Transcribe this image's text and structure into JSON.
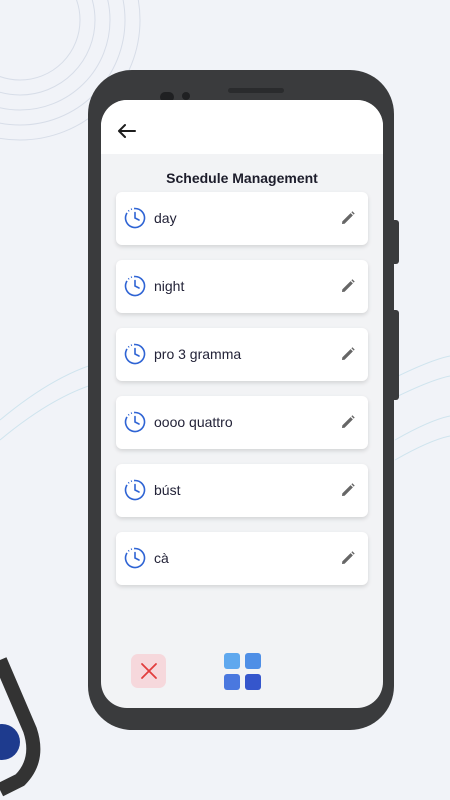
{
  "header": {
    "back_icon": "arrow-left-icon"
  },
  "page": {
    "title": "Schedule Management"
  },
  "schedules": [
    {
      "name": "day"
    },
    {
      "name": "night"
    },
    {
      "name": "pro 3 gramma"
    },
    {
      "name": "oooo quattro"
    },
    {
      "name": "búst"
    },
    {
      "name": "cà"
    }
  ],
  "bottom_bar": {
    "close_icon": "close-x-icon",
    "grid_icon": "grid-icon"
  },
  "colors": {
    "accent": "#2f64d4",
    "close_bg": "#f6d8dc",
    "close_x": "#e23d3d",
    "phone": "#3a3b3d",
    "background": "#f1f3f8"
  }
}
